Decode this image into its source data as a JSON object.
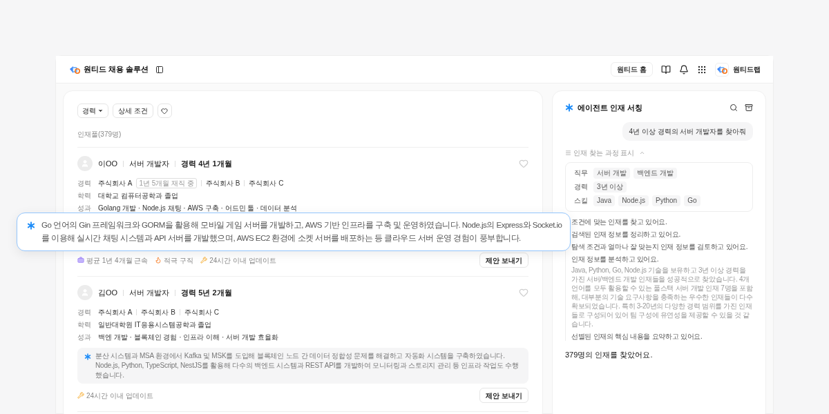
{
  "header": {
    "title": "원티드 채용 솔루션",
    "home_button": "원티드 홈",
    "account": "원티드랩"
  },
  "filters": {
    "career": "경력",
    "detail": "상세 조건"
  },
  "pool_count": "인재풀(379명)",
  "candidates": [
    {
      "name": "이OO",
      "role": "서버 개발자",
      "experience": "경력 4년 1개월",
      "liked": false,
      "rows": [
        {
          "label": "경력",
          "items": [
            {
              "text": "주식회사 A",
              "badge": "1년 5개월 재직 중"
            },
            {
              "text": "주식회사 B"
            },
            {
              "text": "주식회사 C"
            }
          ]
        },
        {
          "label": "학력",
          "items": [
            {
              "text": "대학교 컴퓨터공학과 졸업"
            }
          ]
        },
        {
          "label": "성과",
          "items": [
            {
              "text": "Golang 개발 · Node.js 채팅 · AWS 구축 · 어드민 툴 · 데이터 분석"
            }
          ]
        }
      ],
      "summary_popup": true,
      "summary": "Go 언어의 Gin 프레임워크와 GORM을 활용해 모바일 게임 서버를 개발하고, AWS 기반 인프라를 구축 및 운영하였습니다. Node.js의 Express와 Socket.io를 이용해 실시간 채팅 시스템과 API 서버를 개발했으며, AWS EC2 환경에 소켓 서버를 배포하는 등 클라우드 서버 운영 경험이 풍부합니다.",
      "meta": [
        {
          "kind": "tenure",
          "text": "평균 1년 4개월 근속"
        },
        {
          "kind": "active",
          "text": "적극 구직"
        },
        {
          "kind": "updated",
          "text": "24시간 이내 업데이트"
        }
      ],
      "offer": "제안 보내기"
    },
    {
      "name": "김OO",
      "role": "서버 개발자",
      "experience": "경력 5년 2개월",
      "liked": false,
      "rows": [
        {
          "label": "경력",
          "items": [
            {
              "text": "주식회사 A"
            },
            {
              "text": "주식회사 B"
            },
            {
              "text": "주식회사 C"
            }
          ]
        },
        {
          "label": "학력",
          "items": [
            {
              "text": "일반대학원 IT응용시스템공학과 졸업"
            }
          ]
        },
        {
          "label": "성과",
          "items": [
            {
              "text": "백엔 개발 · 블록체인 경험 · 인프라 이해 · 서버 개발 효율화"
            }
          ]
        }
      ],
      "summary_popup": false,
      "summary": "분산 시스템과 MSA 환경에서 Kafka 및 MSK를 도입해 블록체인 노드 간 데이터 정합성 문제를 해결하고 자동화 시스템을 구축하였습니다. Node.js, Python, TypeScript, NestJS를 활용해 다수의 백엔드 시스템과 REST API를 개발하여 모니터링과 스토리지 관리 등 인프라 작업도 수행했습니다.",
      "meta": [
        {
          "kind": "updated",
          "text": "24시간 이내 업데이트"
        }
      ],
      "offer": "제안 보내기"
    }
  ],
  "agent": {
    "title": "에이전트 인재 서칭",
    "query": "4년 이상 경력의 서버 개발자를 찾아줘",
    "process_toggle": "인재 찾는 과정 표시",
    "process_expanded": true,
    "criteria": [
      {
        "label": "직무",
        "tags": [
          "서버 개발",
          "백엔드 개발"
        ]
      },
      {
        "label": "경력",
        "tags": [
          "3년 이상"
        ]
      },
      {
        "label": "스킬",
        "tags": [
          "Java",
          "Node.js",
          "Python",
          "Go"
        ]
      }
    ],
    "steps": [
      {
        "kind": "step",
        "text": "조건에 맞는 인재를 찾고 있어요."
      },
      {
        "kind": "step",
        "text": "검색된 인재 정보를 정리하고 있어요."
      },
      {
        "kind": "step",
        "text": "탐색 조건과 얼마나 잘 맞는지 인재 정보를 검토하고 있어요."
      },
      {
        "kind": "step",
        "text": "인재 정보를 분석하고 있어요."
      },
      {
        "kind": "detail",
        "text": "Java, Python, Go, Node.js 기술을 보유하고 3년 이상 경력을 가진 서버/백엔드 개발 인재들을 성공적으로 찾았습니다. 4개 언어를 모두 활용할 수 있는 풀스택 서버 개발 인재 7명을 포함해, 대부분의 기술 요구사항을 충족하는 우수한 인재들이 다수 확보되었습니다. 특히 3-20년의 다양한 경력 범위를 가진 인재들로 구성되어 있어 팀 구성에 유연성을 제공할 수 있을 것 같습니다."
      },
      {
        "kind": "step",
        "text": "선별된 인재의 핵심 내용을 요약하고 있어요."
      }
    ],
    "result": "379명의 인재를 찾았어요."
  }
}
